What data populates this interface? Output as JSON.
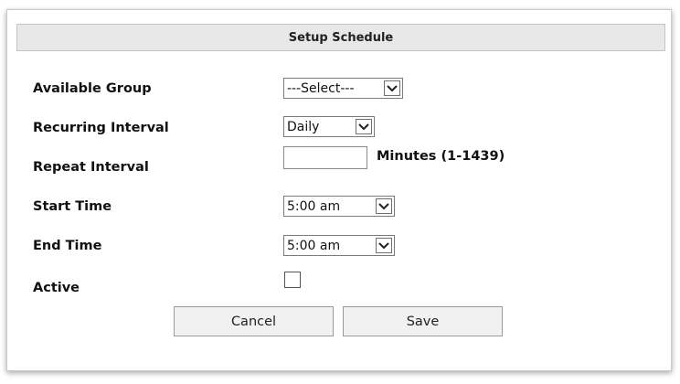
{
  "dialog": {
    "title": "Setup Schedule"
  },
  "form": {
    "available_group": {
      "label": "Available Group",
      "value": "---Select---"
    },
    "recurring_interval": {
      "label": "Recurring Interval",
      "value": "Daily"
    },
    "repeat_interval": {
      "label": "Repeat Interval",
      "value": "",
      "units": "Minutes (1-1439)"
    },
    "start_time": {
      "label": "Start Time",
      "value": "5:00 am"
    },
    "end_time": {
      "label": "End Time",
      "value": "5:00 am"
    },
    "active": {
      "label": "Active",
      "checked": false
    }
  },
  "buttons": {
    "cancel": "Cancel",
    "save": "Save"
  }
}
